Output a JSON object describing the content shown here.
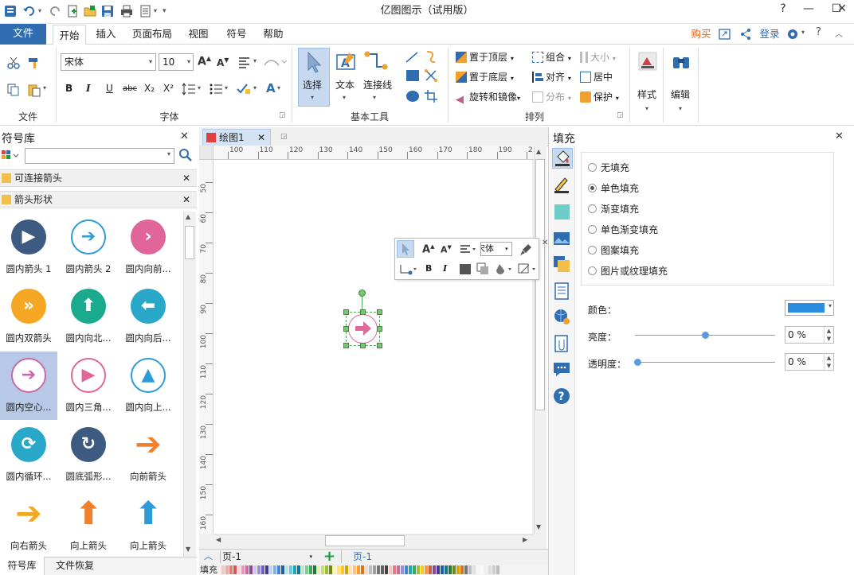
{
  "app": {
    "title": "亿图图示（试用版）"
  },
  "menu": {
    "file": "文件",
    "tabs": [
      "开始",
      "插入",
      "页面布局",
      "视图",
      "符号",
      "帮助"
    ],
    "buy": "购买",
    "login": "登录"
  },
  "ribbon": {
    "groups": {
      "file": "文件",
      "font": "字体",
      "basic_tools": "基本工具",
      "arrange": "排列"
    },
    "font_name": "宋体",
    "font_size": "10",
    "select": "选择",
    "text": "文本",
    "connector": "连接线",
    "bring_front": "置于顶层",
    "send_back": "置于底层",
    "rotate": "旋转和镜像",
    "group": "组合",
    "align": "对齐",
    "distribute": "分布",
    "size": "大小",
    "center": "居中",
    "protect": "保护",
    "style": "样式",
    "edit": "编辑",
    "format_buttons": [
      "B",
      "I",
      "U",
      "abc",
      "X₂",
      "X²"
    ]
  },
  "library": {
    "title": "符号库",
    "search_placeholder": "",
    "sections": [
      "可连接箭头",
      "箭头形状"
    ],
    "shapes": [
      {
        "label": "圆内箭头 1",
        "color": "#3d5a80",
        "glyph": "▶",
        "selected": false
      },
      {
        "label": "圆内箭头 2",
        "color": "#2e9bd6",
        "glyph": "➔",
        "selected": false
      },
      {
        "label": "圆内向前...",
        "color": "#e0669a",
        "glyph": "›",
        "selected": false
      },
      {
        "label": "圆内双箭头",
        "color": "#f5a623",
        "glyph": "»",
        "selected": false
      },
      {
        "label": "圆内向北...",
        "color": "#1aaa8e",
        "glyph": "⬆",
        "selected": false
      },
      {
        "label": "圆内向后...",
        "color": "#2aa8c9",
        "glyph": "⬅",
        "selected": false
      },
      {
        "label": "圆内空心...",
        "color": "#c86aa8",
        "glyph": "➔",
        "selected": true
      },
      {
        "label": "圆内三角...",
        "color": "#e0669a",
        "glyph": "▶",
        "selected": false
      },
      {
        "label": "圆内向上...",
        "color": "#2e9bd6",
        "glyph": "▲",
        "selected": false
      },
      {
        "label": "圆内循环...",
        "color": "#2aa8c9",
        "glyph": "⟳",
        "selected": false
      },
      {
        "label": "圆底弧形...",
        "color": "#3d5a80",
        "glyph": "↻",
        "selected": false
      },
      {
        "label": "向前箭头",
        "color": "#f07f2e",
        "glyph": "➔",
        "selected": false
      },
      {
        "label": "向右箭头",
        "color": "#f5a623",
        "glyph": "➔",
        "selected": false
      },
      {
        "label": "向上箭头",
        "color": "#f07f2e",
        "glyph": "⬆",
        "selected": false
      },
      {
        "label": "向上箭头",
        "color": "#2e9bd6",
        "glyph": "⬆",
        "selected": false
      }
    ],
    "bottom_tabs": [
      "符号库",
      "文件恢复"
    ]
  },
  "document": {
    "tab": "绘图1",
    "ruler_h": [
      "100",
      "110",
      "120",
      "130",
      "140",
      "150",
      "160",
      "170",
      "180",
      "190",
      "2"
    ],
    "ruler_v": [
      "50",
      "60",
      "70",
      "80",
      "90",
      "100",
      "110",
      "120",
      "130",
      "140",
      "150",
      "160"
    ],
    "page_select": "页-1",
    "page_tab": "页-1",
    "fill_label": "填充"
  },
  "minitoolbar": {
    "font": "宋体"
  },
  "fill_panel": {
    "title": "填充",
    "options": [
      "无填充",
      "单色填充",
      "渐变填充",
      "单色渐变填充",
      "图案填充",
      "图片或纹理填充"
    ],
    "selected": "单色填充",
    "color_label": "颜色：",
    "color_value": "#2b8de0",
    "brightness_label": "亮度：",
    "brightness_value": "0 %",
    "transparency_label": "透明度：",
    "transparency_value": "0 %",
    "brightness_fraction": 0.5,
    "transparency_fraction": 0.0
  }
}
